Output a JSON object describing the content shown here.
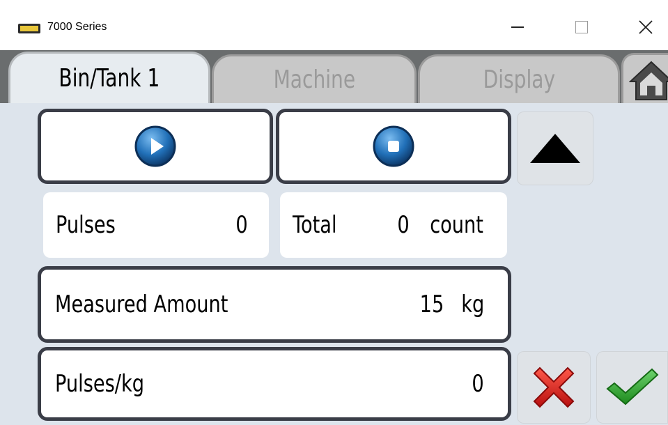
{
  "window": {
    "title": "7000 Series",
    "app_icon": "device-icon",
    "controls": [
      "minimize-icon",
      "maximize-icon",
      "close-icon"
    ]
  },
  "tabs": [
    {
      "label": "Bin/Tank 1",
      "active": true
    },
    {
      "label": "Machine",
      "active": false
    },
    {
      "label": "Display",
      "active": false
    }
  ],
  "home_icon": "home-icon",
  "controls": {
    "start_icon": "play-icon",
    "stop_icon": "stop-icon",
    "up_icon": "up-arrow-icon"
  },
  "readouts": {
    "pulses_label": "Pulses",
    "pulses_value": "0",
    "total_label": "Total",
    "total_value": "0",
    "total_unit": "count"
  },
  "measured": {
    "label": "Measured Amount",
    "value": "15",
    "unit": "kg"
  },
  "pulses_per_kg": {
    "label": "Pulses/kg",
    "value": "0"
  },
  "actions": {
    "cancel_icon": "red-x-icon",
    "confirm_icon": "green-check-icon"
  },
  "colors": {
    "content_bg": "#dde4ec",
    "tab_bar": "#6a6d6e",
    "play_blue": "#1d5f9f",
    "cancel_red": "#e02020",
    "confirm_green": "#2faa2f"
  }
}
